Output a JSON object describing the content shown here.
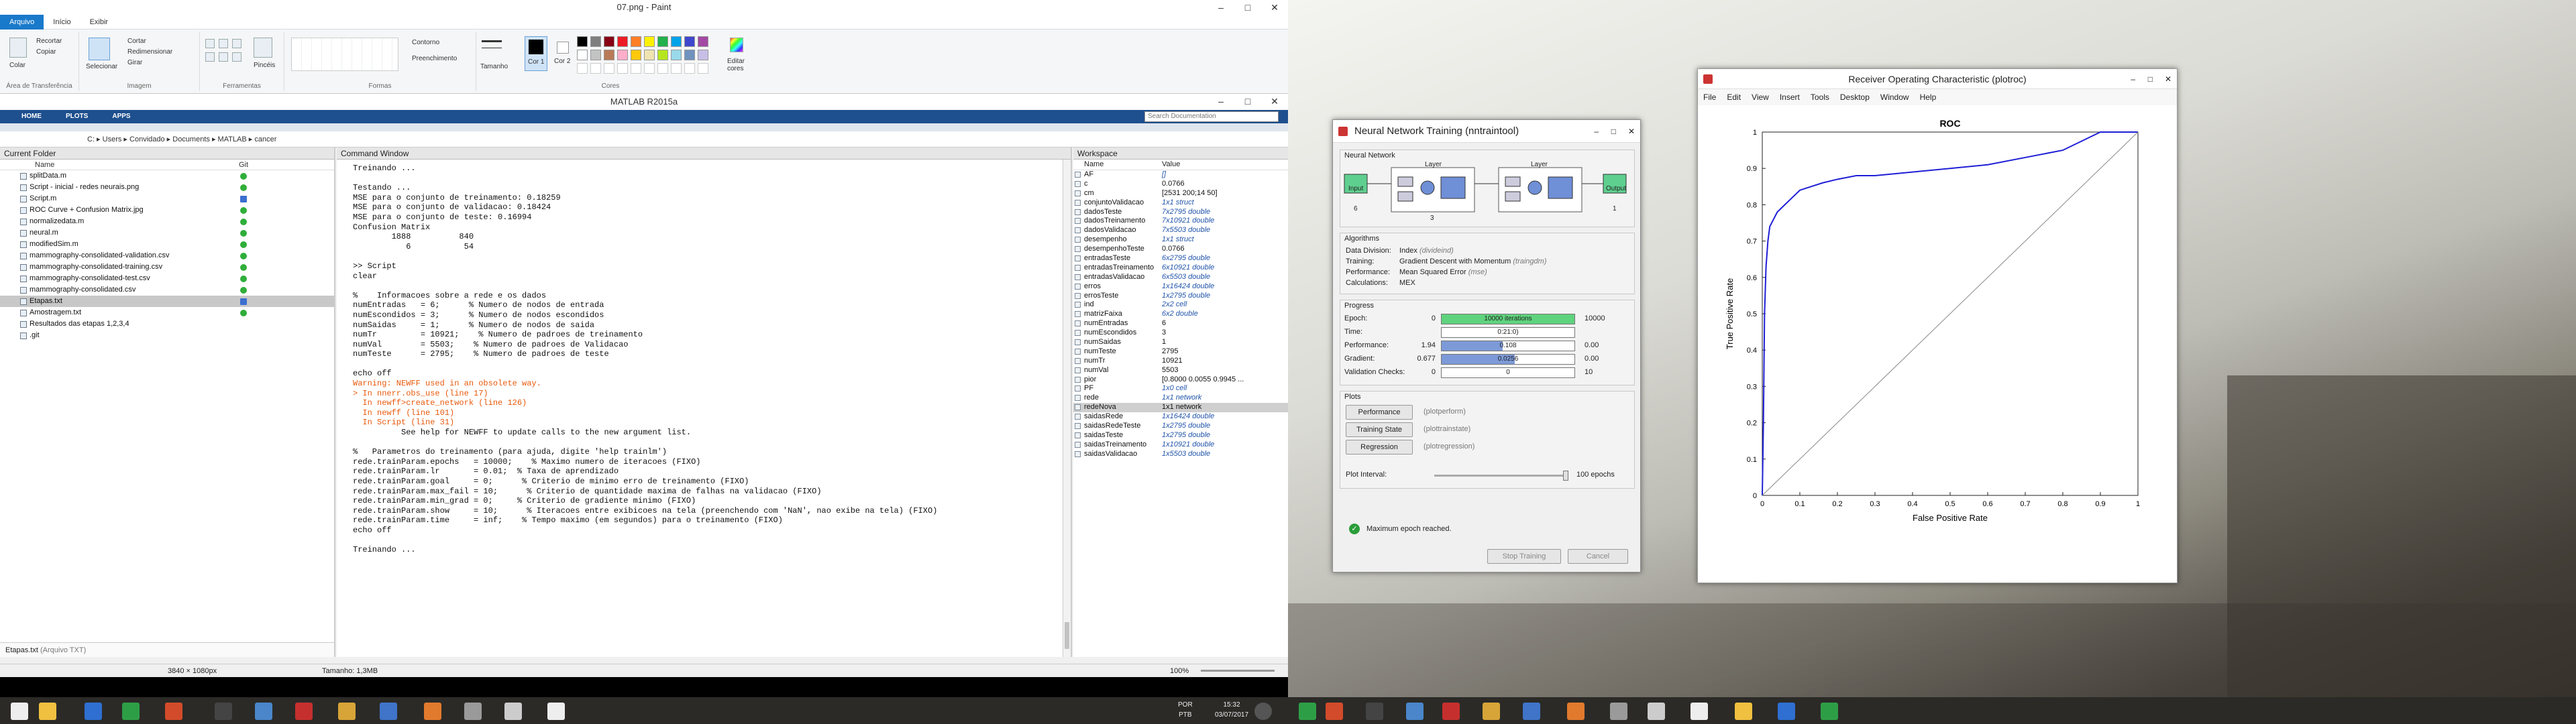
{
  "paint": {
    "title": "07.png - Paint",
    "tabs": [
      "Arquivo",
      "Início",
      "Exibir"
    ],
    "groups": {
      "clipboard": "Área de Transferência",
      "image": "Imagem",
      "tools": "Ferramentas",
      "shapes": "Formas",
      "colors": "Cores"
    },
    "buttons": {
      "paste": "Colar",
      "cut": "Recortar",
      "copy": "Copiar",
      "select": "Selecionar",
      "crop": "Cortar",
      "resize": "Redimensionar",
      "rotate": "Girar",
      "brushes": "Pincéis",
      "outline": "Contorno",
      "fill": "Preenchimento",
      "size": "Tamanho",
      "color1": "Cor 1",
      "color2": "Cor 2",
      "edit_colors": "Editar cores"
    },
    "palette": [
      "#000000",
      "#7f7f7f",
      "#880015",
      "#ed1c24",
      "#ff7f27",
      "#fff200",
      "#22b14c",
      "#00a2e8",
      "#3f48cc",
      "#a349a4",
      "#ffffff",
      "#c3c3c3",
      "#b97a57",
      "#ffaec9",
      "#ffc90e",
      "#efe4b0",
      "#b5e61d",
      "#99d9ea",
      "#7092be",
      "#c8bfe7"
    ]
  },
  "matlab": {
    "title": "MATLAB R2015a",
    "tabs": [
      "HOME",
      "PLOTS",
      "APPS"
    ],
    "search_placeholder": "Search Documentation",
    "path": [
      "C:",
      "Users",
      "Convidado",
      "Documents",
      "MATLAB",
      "cancer"
    ],
    "folder_title": "Current Folder",
    "folder_col_name": "Name",
    "folder_col_git": "Git",
    "files": [
      {
        "name": "splitData.m",
        "git": "green"
      },
      {
        "name": "Script - inicial - redes neurais.png",
        "git": "green"
      },
      {
        "name": "Script.m",
        "git": "blue"
      },
      {
        "name": "ROC Curve + Confusion Matrix.jpg",
        "git": "green"
      },
      {
        "name": "normalizedata.m",
        "git": "green"
      },
      {
        "name": "neural.m",
        "git": "green"
      },
      {
        "name": "modifiedSim.m",
        "git": "green"
      },
      {
        "name": "mammography-consolidated-validation.csv",
        "git": "green"
      },
      {
        "name": "mammography-consolidated-training.csv",
        "git": "green"
      },
      {
        "name": "mammography-consolidated-test.csv",
        "git": "green"
      },
      {
        "name": "mammography-consolidated.csv",
        "git": "green"
      },
      {
        "name": "Etapas.txt",
        "git": "blue",
        "selected": true
      },
      {
        "name": "Amostragem.txt",
        "git": "green"
      },
      {
        "name": "Resultados das etapas 1,2,3,4",
        "git": ""
      },
      {
        "name": ".git",
        "git": ""
      }
    ],
    "details_label": "Etapas.txt",
    "details_type": "(Arquivo TXT)",
    "command_title": "Command Window",
    "command_lines": [
      {
        "t": "Treinando ...",
        "c": ""
      },
      {
        "t": "",
        "c": ""
      },
      {
        "t": "Testando ...",
        "c": ""
      },
      {
        "t": "MSE para o conjunto de treinamento: 0.18259",
        "c": ""
      },
      {
        "t": "MSE para o conjunto de validacao: 0.18424",
        "c": ""
      },
      {
        "t": "MSE para o conjunto de teste: 0.16994",
        "c": ""
      },
      {
        "t": "Confusion Matrix",
        "c": ""
      },
      {
        "t": "        1888          840",
        "c": ""
      },
      {
        "t": "           6           54",
        "c": ""
      },
      {
        "t": "",
        "c": ""
      },
      {
        "t": ">> Script",
        "c": ""
      },
      {
        "t": "clear",
        "c": ""
      },
      {
        "t": "",
        "c": ""
      },
      {
        "t": "%    Informacoes sobre a rede e os dados",
        "c": ""
      },
      {
        "t": "numEntradas   = 6;      % Numero de nodos de entrada",
        "c": ""
      },
      {
        "t": "numEscondidos = 3;      % Numero de nodos escondidos",
        "c": ""
      },
      {
        "t": "numSaidas     = 1;      % Numero de nodos de saida",
        "c": ""
      },
      {
        "t": "numTr         = 10921;    % Numero de padroes de treinamento",
        "c": ""
      },
      {
        "t": "numVal        = 5503;    % Numero de padroes de Validacao",
        "c": ""
      },
      {
        "t": "numTeste      = 2795;    % Numero de padroes de teste",
        "c": ""
      },
      {
        "t": "",
        "c": ""
      },
      {
        "t": "echo off",
        "c": ""
      },
      {
        "t": "Warning: NEWFF used in an obsolete way.",
        "c": "warn"
      },
      {
        "t": "> In nnerr.obs_use (line 17)",
        "c": "warn"
      },
      {
        "t": "  In newff>create_network (line 126)",
        "c": "warn"
      },
      {
        "t": "  In newff (line 101)",
        "c": "warn"
      },
      {
        "t": "  In Script (line 31)",
        "c": "warn"
      },
      {
        "t": "          See help for NEWFF to update calls to the new argument list.",
        "c": ""
      },
      {
        "t": "",
        "c": ""
      },
      {
        "t": "%   Parametros do treinamento (para ajuda, digite 'help trainlm')",
        "c": ""
      },
      {
        "t": "rede.trainParam.epochs   = 10000;    % Maximo numero de iteracoes (FIXO)",
        "c": ""
      },
      {
        "t": "rede.trainParam.lr       = 0.01;  % Taxa de aprendizado",
        "c": ""
      },
      {
        "t": "rede.trainParam.goal     = 0;      % Criterio de minimo erro de treinamento (FIXO)",
        "c": ""
      },
      {
        "t": "rede.trainParam.max_fail = 10;      % Criterio de quantidade maxima de falhas na validacao (FIXO)",
        "c": ""
      },
      {
        "t": "rede.trainParam.min_grad = 0;     % Criterio de gradiente minimo (FIXO)",
        "c": ""
      },
      {
        "t": "rede.trainParam.show     = 10;      % Iteracoes entre exibicoes na tela (preenchendo com 'NaN', nao exibe na tela) (FIXO)",
        "c": ""
      },
      {
        "t": "rede.trainParam.time     = inf;    % Tempo maximo (em segundos) para o treinamento (FIXO)",
        "c": ""
      },
      {
        "t": "echo off",
        "c": ""
      },
      {
        "t": "",
        "c": ""
      },
      {
        "t": "Treinando ...",
        "c": ""
      }
    ],
    "workspace_title": "Workspace",
    "ws_col_name": "Name",
    "ws_col_value": "Value",
    "workspace": [
      {
        "n": "AF",
        "v": "[]",
        "it": true
      },
      {
        "n": "c",
        "v": "0.0766",
        "it": false
      },
      {
        "n": "cm",
        "v": "[2531 200;14 50]",
        "it": false
      },
      {
        "n": "conjuntoValidacao",
        "v": "1x1 struct",
        "it": true
      },
      {
        "n": "dadosTeste",
        "v": "7x2795 double",
        "it": true
      },
      {
        "n": "dadosTreinamento",
        "v": "7x10921 double",
        "it": true
      },
      {
        "n": "dadosValidacao",
        "v": "7x5503 double",
        "it": true
      },
      {
        "n": "desempenho",
        "v": "1x1 struct",
        "it": true
      },
      {
        "n": "desempenhoTeste",
        "v": "0.0766",
        "it": false
      },
      {
        "n": "entradasTeste",
        "v": "6x2795 double",
        "it": true
      },
      {
        "n": "entradasTreinamento",
        "v": "6x10921 double",
        "it": true
      },
      {
        "n": "entradasValidacao",
        "v": "6x5503 double",
        "it": true
      },
      {
        "n": "erros",
        "v": "1x16424 double",
        "it": true
      },
      {
        "n": "errosTeste",
        "v": "1x2795 double",
        "it": true
      },
      {
        "n": "ind",
        "v": "2x2 cell",
        "it": true
      },
      {
        "n": "matrizFaixa",
        "v": "6x2 double",
        "it": true
      },
      {
        "n": "numEntradas",
        "v": "6",
        "it": false
      },
      {
        "n": "numEscondidos",
        "v": "3",
        "it": false
      },
      {
        "n": "numSaidas",
        "v": "1",
        "it": false
      },
      {
        "n": "numTeste",
        "v": "2795",
        "it": false
      },
      {
        "n": "numTr",
        "v": "10921",
        "it": false
      },
      {
        "n": "numVal",
        "v": "5503",
        "it": false
      },
      {
        "n": "pior",
        "v": "[0.8000 0.0055 0.9945 ...",
        "it": false
      },
      {
        "n": "PF",
        "v": "1x0 cell",
        "it": true
      },
      {
        "n": "rede",
        "v": "1x1 network",
        "it": true
      },
      {
        "n": "redeNova",
        "v": "1x1 network",
        "it": false,
        "sel": true
      },
      {
        "n": "saidasRede",
        "v": "1x16424 double",
        "it": true
      },
      {
        "n": "saidasRedeTeste",
        "v": "1x2795 double",
        "it": true
      },
      {
        "n": "saidasTeste",
        "v": "1x2795 double",
        "it": true
      },
      {
        "n": "saidasTreinamento",
        "v": "1x10921 double",
        "it": true
      },
      {
        "n": "saidasValidacao",
        "v": "1x5503 double",
        "it": true
      }
    ]
  },
  "paint_status": {
    "dims": "3840 × 1080px",
    "size": "Tamanho: 1,3MB",
    "zoom": "100%"
  },
  "nntrain": {
    "title": "Neural Network Training (nntraintool)",
    "sec_network": "Neural Network",
    "input_label": "Input",
    "input_n": "6",
    "layer_label": "Layer",
    "hidden_n": "3",
    "output_label": "Output",
    "output_n": "1",
    "sec_algorithms": "Algorithms",
    "algorithms": [
      {
        "k": "Data Division:",
        "v": "Index",
        "h": "(divideind)"
      },
      {
        "k": "Training:",
        "v": "Gradient Descent with Momentum",
        "h": "(traingdm)"
      },
      {
        "k": "Performance:",
        "v": "Mean Squared Error",
        "h": "(mse)"
      },
      {
        "k": "Calculations:",
        "v": "MEX",
        "h": ""
      }
    ],
    "sec_progress": "Progress",
    "progress": [
      {
        "l": "Epoch:",
        "min": "0",
        "txt": "10000 iterations",
        "max": "10000",
        "frac": 1.0,
        "color": "#5fd37d"
      },
      {
        "l": "Time:",
        "min": "",
        "txt": "0:21:0)",
        "max": "",
        "frac": 0.0,
        "color": "#ffffff"
      },
      {
        "l": "Performance:",
        "min": "1.94",
        "txt": "0.108",
        "max": "0.00",
        "frac": 0.46,
        "color": "#7d9ad8"
      },
      {
        "l": "Gradient:",
        "min": "0.677",
        "txt": "0.0256",
        "max": "0.00",
        "frac": 0.55,
        "color": "#7d9ad8"
      },
      {
        "l": "Validation Checks:",
        "min": "0",
        "txt": "0",
        "max": "10",
        "frac": 0.0,
        "color": "#ffffff"
      }
    ],
    "sec_plots": "Plots",
    "plots": [
      {
        "b": "Performance",
        "f": "(plotperform)"
      },
      {
        "b": "Training State",
        "f": "(plottrainstate)"
      },
      {
        "b": "Regression",
        "f": "(plotregression)"
      }
    ],
    "plot_interval_label": "Plot Interval:",
    "plot_interval_value": "100 epochs",
    "plot_interval_frac": 1.0,
    "status": "Maximum epoch reached.",
    "stop_button": "Stop Training",
    "cancel_button": "Cancel"
  },
  "roc": {
    "window_title": "Receiver Operating Characteristic (plotroc)",
    "menu": [
      "File",
      "Edit",
      "View",
      "Insert",
      "Tools",
      "Desktop",
      "Window",
      "Help"
    ]
  },
  "taskbar": {
    "lang1": "POR",
    "lang2": "PTB",
    "time": "15:32",
    "date": "03/07/2017"
  },
  "chart_data": {
    "type": "line",
    "title": "ROC",
    "xlabel": "False Positive Rate",
    "ylabel": "True Positive Rate",
    "xlim": [
      0,
      1
    ],
    "ylim": [
      0,
      1
    ],
    "xticks": [
      "0",
      "0.1",
      "0.2",
      "0.3",
      "0.4",
      "0.5",
      "0.6",
      "0.7",
      "0.8",
      "0.9",
      "1"
    ],
    "yticks": [
      "0",
      "0.1",
      "0.2",
      "0.3",
      "0.4",
      "0.5",
      "0.6",
      "0.7",
      "0.8",
      "0.9",
      "1"
    ],
    "series": [
      {
        "color": "#1f1fd6",
        "x": [
          0,
          0.003,
          0.006,
          0.01,
          0.015,
          0.02,
          0.03,
          0.04,
          0.06,
          0.08,
          0.1,
          0.13,
          0.16,
          0.2,
          0.25,
          0.3,
          0.4,
          0.5,
          0.6,
          0.7,
          0.8,
          0.9,
          1.0
        ],
        "y": [
          0,
          0.2,
          0.5,
          0.63,
          0.7,
          0.74,
          0.76,
          0.78,
          0.8,
          0.82,
          0.84,
          0.85,
          0.86,
          0.87,
          0.88,
          0.88,
          0.89,
          0.9,
          0.91,
          0.93,
          0.95,
          1.0,
          1.0
        ]
      },
      {
        "color": "#888888",
        "x": [
          0,
          1
        ],
        "y": [
          0,
          1
        ]
      }
    ],
    "grid": false
  }
}
